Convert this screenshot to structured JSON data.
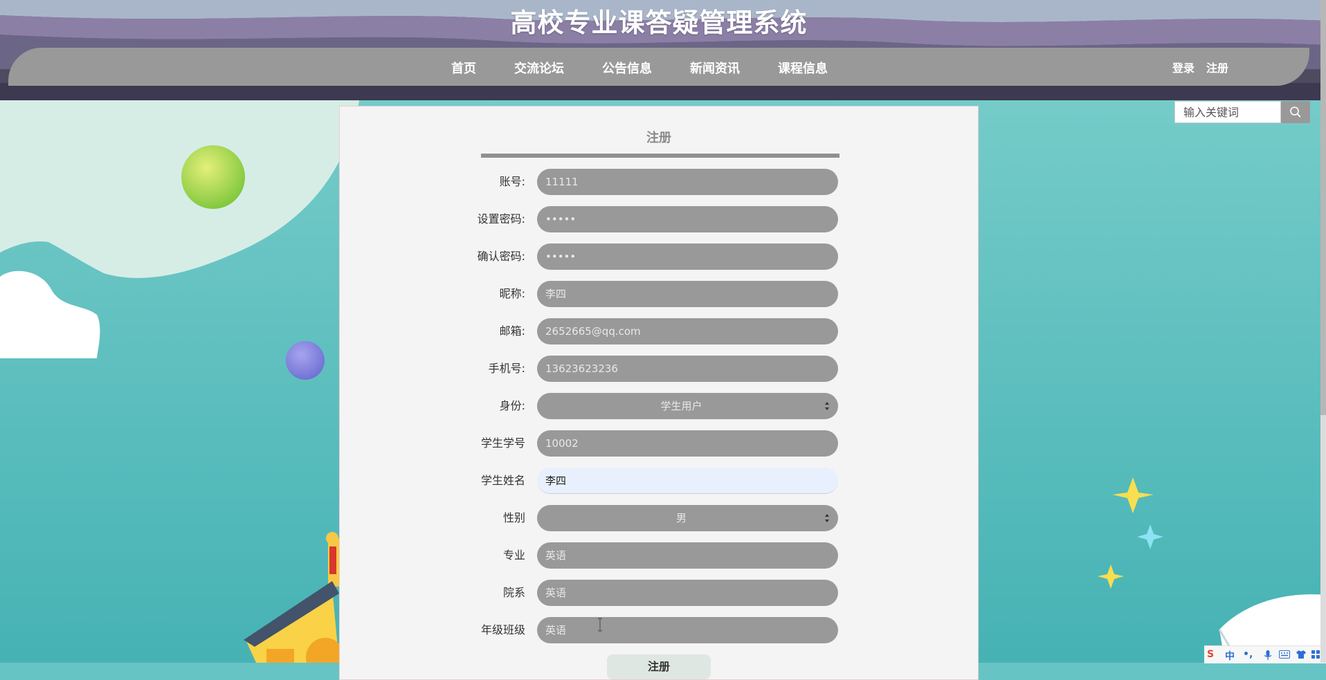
{
  "header": {
    "site_title": "高校专业课答疑管理系统",
    "nav": [
      "首页",
      "交流论坛",
      "公告信息",
      "新闻资讯",
      "课程信息"
    ],
    "login_label": "登录",
    "register_label": "注册"
  },
  "search": {
    "placeholder": "输入关键词"
  },
  "form": {
    "title": "注册",
    "fields": [
      {
        "label": "账号:",
        "value": "11111"
      },
      {
        "label": "设置密码:",
        "value": "•••••"
      },
      {
        "label": "确认密码:",
        "value": "•••••"
      },
      {
        "label": "昵称:",
        "value": "李四"
      },
      {
        "label": "邮箱:",
        "value": "2652665@qq.com"
      },
      {
        "label": "手机号:",
        "value": "13623623236"
      },
      {
        "label": "身份:",
        "value": "学生用户"
      },
      {
        "label": "学生学号",
        "value": "10002"
      },
      {
        "label": "学生姓名",
        "value": "李四"
      },
      {
        "label": "性别",
        "value": "男"
      },
      {
        "label": "专业",
        "value": "英语"
      },
      {
        "label": "院系",
        "value": "英语"
      },
      {
        "label": "年级班级",
        "value": "英语"
      }
    ],
    "submit_label": "注册"
  },
  "ime": {
    "brand": "S",
    "mode": "中",
    "punct": "•,",
    "mic": "mic-icon",
    "keyboard": "keyboard-icon",
    "skin": "shirt-icon",
    "apps": "grid-icon"
  },
  "colors": {
    "navbar": "#999999",
    "field_bg": "#999999",
    "active_field_bg": "#e8f0fd",
    "panel_bg": "#f4f4f4"
  }
}
